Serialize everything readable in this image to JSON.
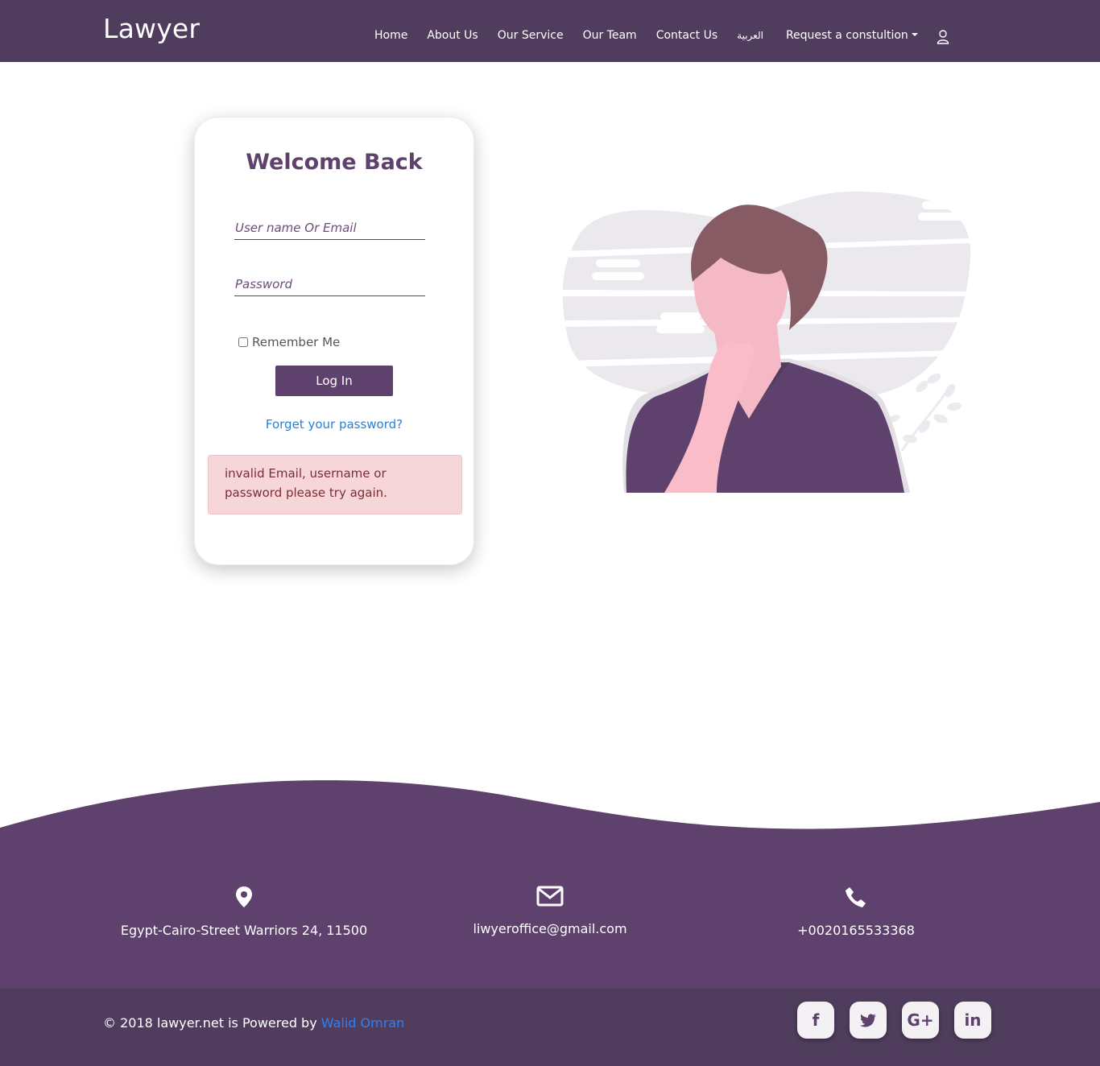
{
  "navbar": {
    "brand": "Lawyer",
    "links": [
      "Home",
      "About Us",
      "Our Service",
      "Our Team",
      "Contact Us",
      "العربية"
    ],
    "dropdown": "Request a constultion"
  },
  "login": {
    "title": "Welcome Back",
    "username_placeholder": "User name Or Email",
    "password_placeholder": "Password",
    "remember_label": "Remember Me",
    "login_button": "Log In",
    "forget_link": "Forget your password?",
    "error_message": "invalid Email, username or password please try again."
  },
  "footer": {
    "address": "Egypt-Cairo-Street Warriors 24, 11500",
    "email": "liwyeroffice@gmail.com",
    "phone": "+0020165533368",
    "copyright": "© 2018 lawyer.net is Powered by",
    "author": "Walid Omran",
    "social": [
      "f",
      "t",
      "G+",
      "in"
    ]
  },
  "colors": {
    "primary": "#5f416e",
    "navbar": "#503d5d",
    "link": "#2a7fd4",
    "alert_bg": "#f7d6da"
  },
  "icons": [
    "user-icon",
    "location-pin-icon",
    "envelope-icon",
    "phone-icon",
    "facebook-icon",
    "twitter-icon",
    "google-plus-icon",
    "linkedin-icon"
  ]
}
